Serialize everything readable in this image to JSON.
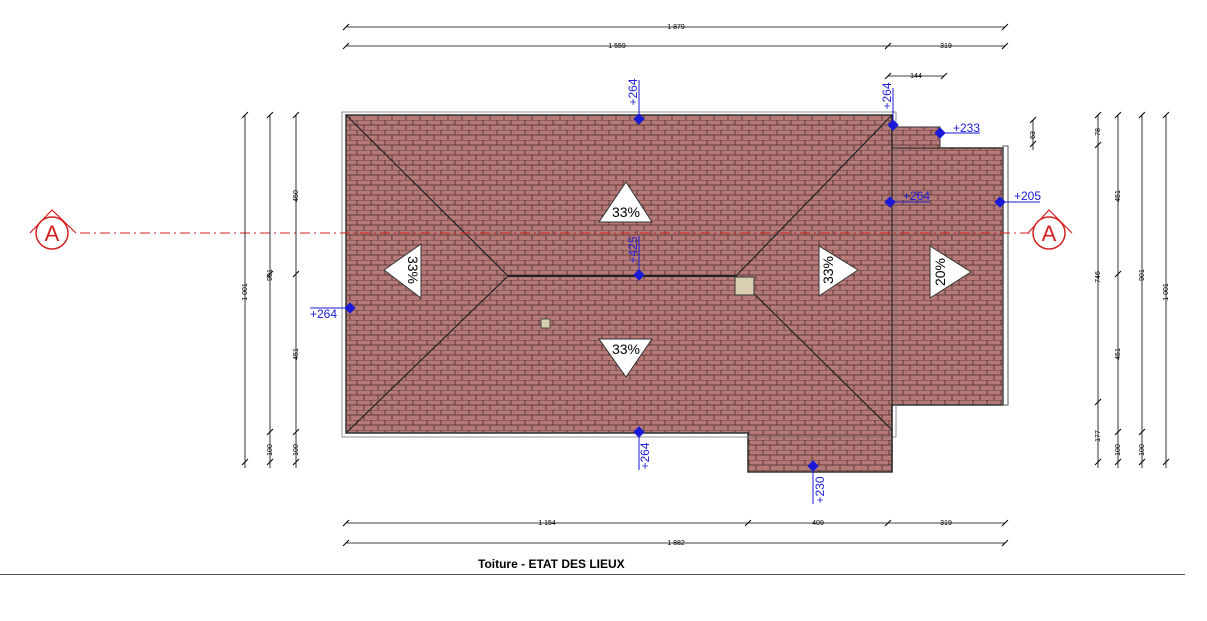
{
  "caption": "Toiture - ETAT DES LIEUX",
  "colors": {
    "tile": "#b57a78",
    "tile_line": "#4a2a28",
    "elevation": "#1a1ad6",
    "section": "#d32020"
  },
  "dimensions": {
    "top_total": "1 879",
    "top_a": "1 559",
    "top_b": "319",
    "annex_width": "144",
    "bottom_a": "1 154",
    "bottom_b": "409",
    "bottom_c": "319",
    "bottom_total": "1 882",
    "left_450": "450",
    "left_451": "451",
    "left_100a": "100",
    "left_100b": "100",
    "left_901": "901",
    "left_1001": "1 001",
    "right_63": "63",
    "right_78": "78",
    "right_451a": "451",
    "right_746": "746",
    "right_451b": "451",
    "right_177": "177",
    "right_100a": "100",
    "right_100b": "100",
    "right_901": "901",
    "right_1001": "1 001"
  },
  "elevations": {
    "top_ridge": "+264",
    "left": "+264",
    "center": "+425",
    "bottom": "+264",
    "annex_bottom": "+230",
    "corner": "+264",
    "notch": "+233",
    "mid_right": "+264",
    "far_right": "+205"
  },
  "slopes": {
    "north": "33%",
    "west": "33%",
    "south": "33%",
    "east": "33%",
    "annex": "20%"
  },
  "section": {
    "left_label": "A",
    "right_label": "A"
  }
}
